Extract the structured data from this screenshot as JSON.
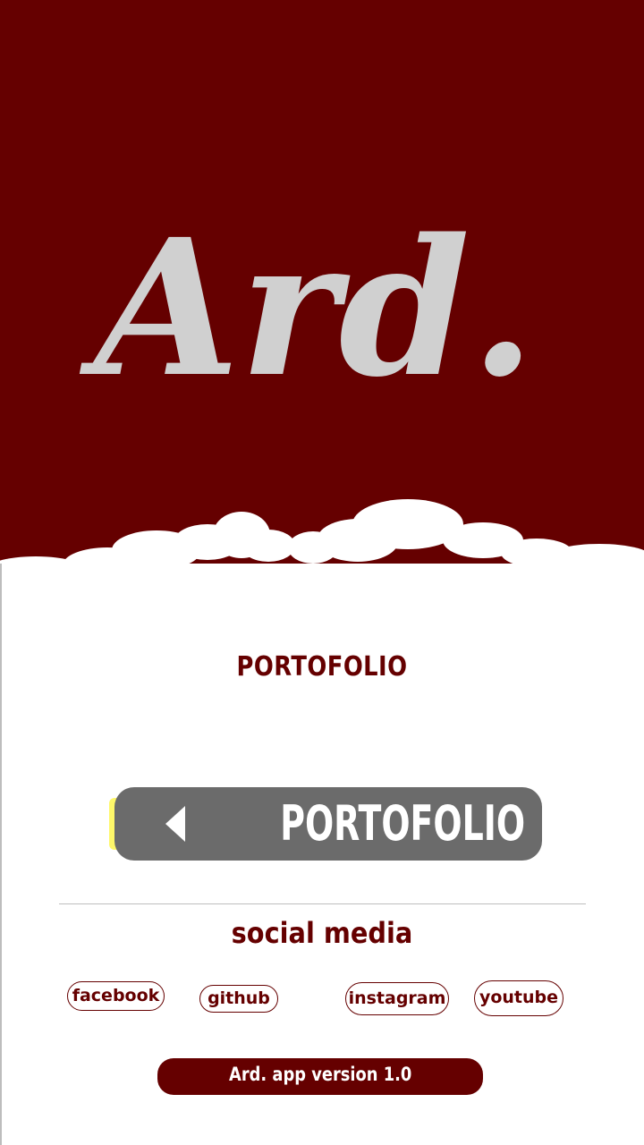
{
  "app": {
    "logo_text": "Ard.",
    "colors": {
      "brand": "#650000",
      "logo": "#d0d0d0",
      "button": "#6b6b6b",
      "accent": "#fff86a",
      "background": "#ffffff"
    }
  },
  "main": {
    "section_title": "PORTOFOLIO",
    "slider": {
      "label": "PORTOFOLIO",
      "icon": "triangle-left-icon"
    }
  },
  "social": {
    "title": "social media",
    "links": [
      {
        "label": "facebook"
      },
      {
        "label": "github"
      },
      {
        "label": "instagram"
      },
      {
        "label": "youtube"
      }
    ]
  },
  "footer": {
    "version": "Ard. app version 1.0"
  }
}
